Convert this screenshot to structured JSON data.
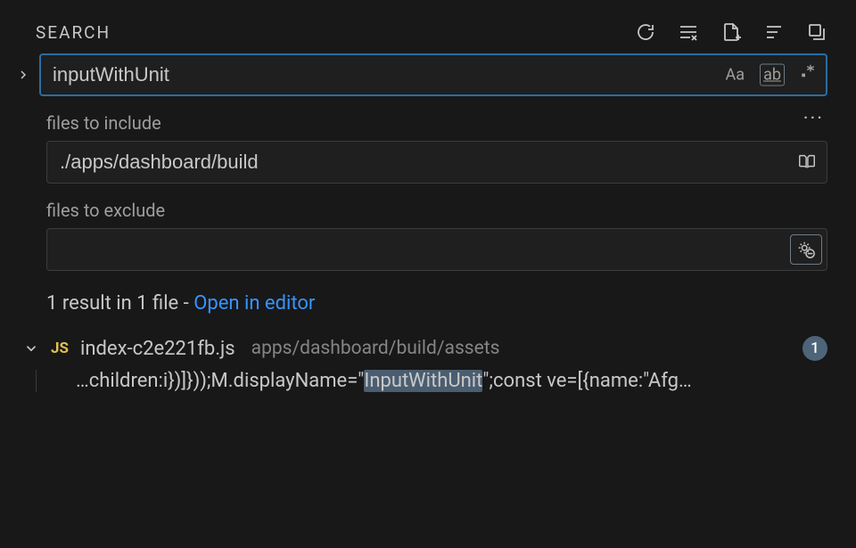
{
  "header": {
    "title": "SEARCH",
    "actions": {
      "refresh": "refresh-icon",
      "clear": "clear-results-icon",
      "newfile": "new-file-icon",
      "viewtree": "view-as-tree-icon",
      "collapse": "collapse-all-icon"
    }
  },
  "search": {
    "query": "inputWithUnit",
    "case_label": "Aa",
    "word_label": "ab",
    "regex_label": ".*"
  },
  "include": {
    "label": "files to include",
    "value": "./apps/dashboard/build"
  },
  "exclude": {
    "label": "files to exclude",
    "value": ""
  },
  "summary": {
    "text": "1 result in 1 file - ",
    "link": "Open in editor"
  },
  "results": {
    "files": [
      {
        "icon": "JS",
        "name": "index-c2e221fb.js",
        "path": "apps/dashboard/build/assets",
        "count": "1",
        "match": {
          "pre": "…children:i})]}));M.displayName=\"",
          "hit": "InputWithUnit",
          "post": "\";const ve=[{name:\"Afg…"
        }
      }
    ]
  }
}
